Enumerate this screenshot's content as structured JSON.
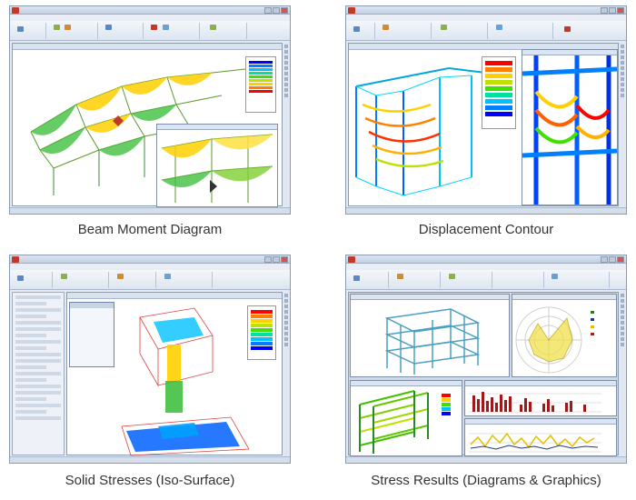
{
  "captions": {
    "beam_moment": "Beam Moment Diagram",
    "displacement": "Displacement Contour",
    "solid_stresses": "Solid Stresses (Iso-Surface)",
    "stress_results": "Stress Results (Diagrams & Graphics)"
  },
  "colors": {
    "frame_bg": "#e4eaf3",
    "ribbon_top": "#f4f7fb",
    "accent_red": "#c0392b",
    "contour": [
      "#0000ff",
      "#0080ff",
      "#00c0ff",
      "#00e0a0",
      "#40e000",
      "#c0e000",
      "#ffd000",
      "#ff8000",
      "#ff0000"
    ]
  },
  "icons": [
    "app-logo-icon",
    "minimize-icon",
    "maximize-icon",
    "close-icon"
  ]
}
